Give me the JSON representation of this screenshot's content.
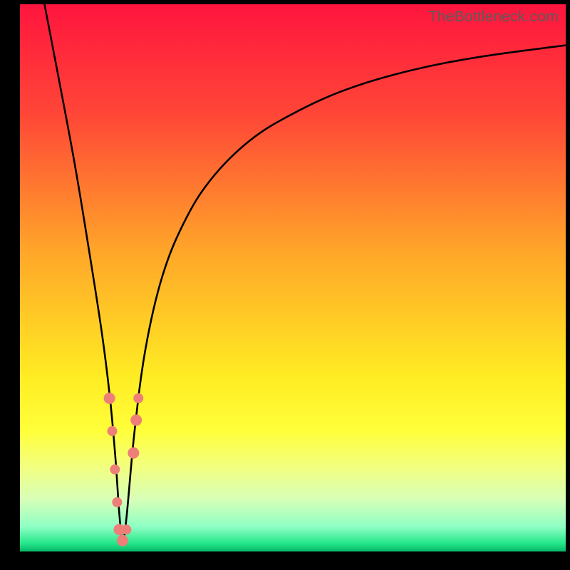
{
  "watermark": "TheBottleneck.com",
  "chart_data": {
    "type": "line",
    "title": "",
    "xlabel": "",
    "ylabel": "",
    "xlim": [
      0,
      100
    ],
    "ylim": [
      0,
      100
    ],
    "gradient_stops": [
      {
        "offset": 0,
        "color": "#ff153e"
      },
      {
        "offset": 0.2,
        "color": "#ff4637"
      },
      {
        "offset": 0.45,
        "color": "#ffa529"
      },
      {
        "offset": 0.68,
        "color": "#ffec23"
      },
      {
        "offset": 0.78,
        "color": "#ffff3a"
      },
      {
        "offset": 0.84,
        "color": "#f4ff7a"
      },
      {
        "offset": 0.905,
        "color": "#d7ffb8"
      },
      {
        "offset": 0.955,
        "color": "#8effc4"
      },
      {
        "offset": 0.985,
        "color": "#25e68a"
      },
      {
        "offset": 1.0,
        "color": "#06b867"
      }
    ],
    "series": [
      {
        "name": "bottleneck-curve",
        "x": [
          4.5,
          7.0,
          10.0,
          12.5,
          15.0,
          16.5,
          17.5,
          18.2,
          18.8,
          19.5,
          21.0,
          23.0,
          26.0,
          30.0,
          35.0,
          42.0,
          50.0,
          60.0,
          72.0,
          85.0,
          100.0
        ],
        "values": [
          100,
          87,
          71,
          56,
          40,
          28,
          17,
          7,
          2,
          6,
          22,
          37,
          50,
          60,
          68,
          75,
          80,
          84.5,
          88,
          90.5,
          92.5
        ]
      }
    ],
    "markers": {
      "name": "highlight-dots",
      "color": "#ed7f78",
      "points": [
        {
          "x": 16.4,
          "y": 28,
          "r": 8
        },
        {
          "x": 16.9,
          "y": 22,
          "r": 7
        },
        {
          "x": 17.4,
          "y": 15,
          "r": 7
        },
        {
          "x": 17.8,
          "y": 9,
          "r": 7
        },
        {
          "x": 18.2,
          "y": 4,
          "r": 8
        },
        {
          "x": 18.8,
          "y": 2,
          "r": 8
        },
        {
          "x": 19.5,
          "y": 4,
          "r": 7
        },
        {
          "x": 20.8,
          "y": 18,
          "r": 8
        },
        {
          "x": 21.3,
          "y": 24,
          "r": 8
        },
        {
          "x": 21.7,
          "y": 28,
          "r": 7
        }
      ]
    }
  }
}
